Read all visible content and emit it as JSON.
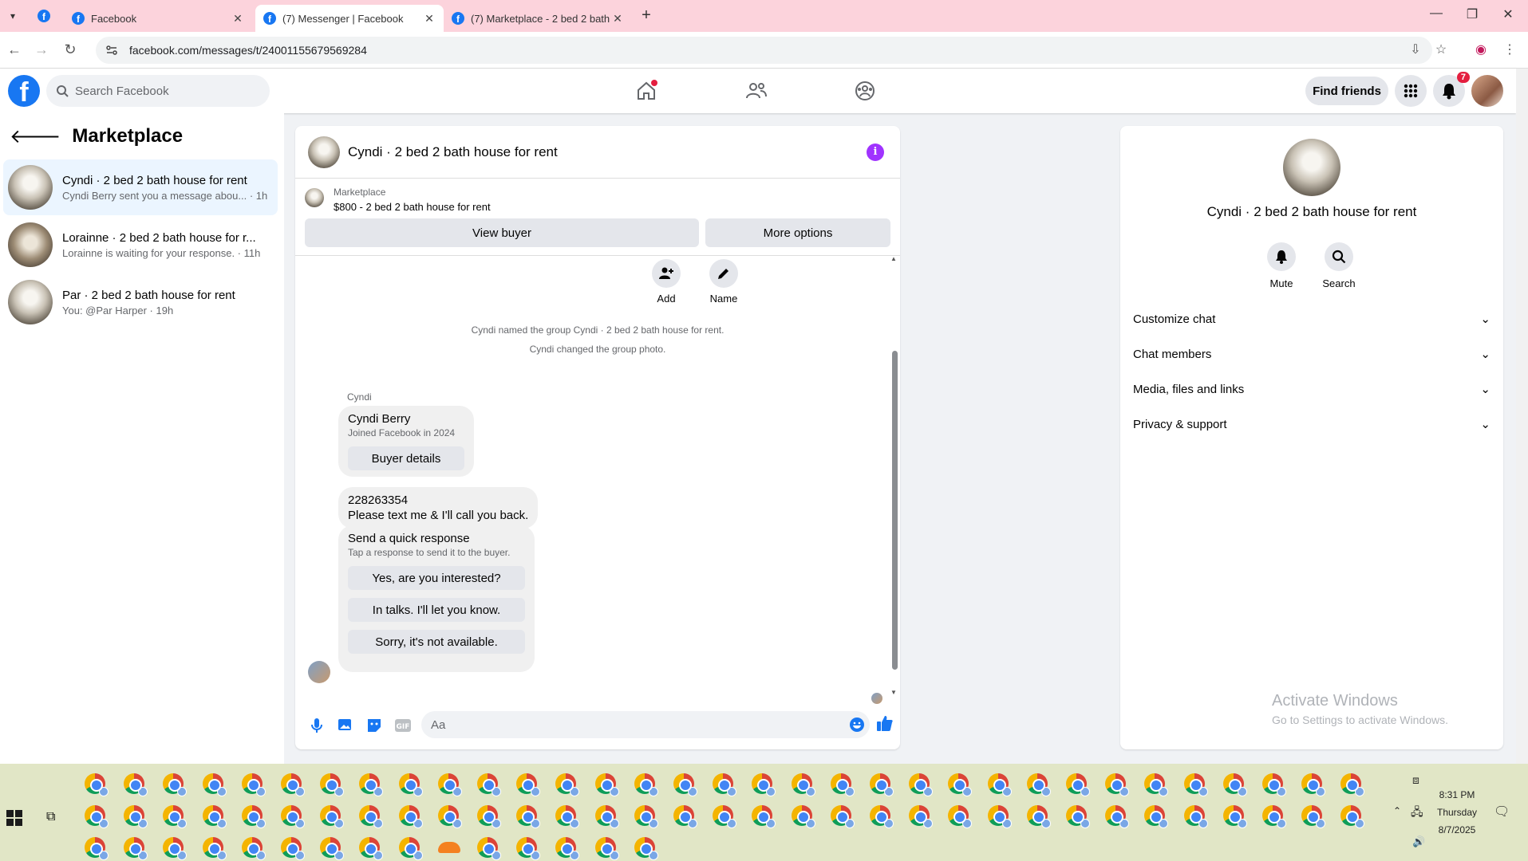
{
  "browser": {
    "tabs": [
      {
        "title": "Facebook",
        "active": false
      },
      {
        "title": "(7) Messenger | Facebook",
        "active": true
      },
      {
        "title": "(7) Marketplace - 2 bed 2 bath",
        "active": false
      }
    ],
    "url": "facebook.com/messages/t/24001155679569284"
  },
  "fb_header": {
    "logo": "f",
    "search_placeholder": "Search Facebook",
    "nav_icons": [
      "home-icon",
      "friends-icon",
      "groups-icon"
    ],
    "find_friends_label": "Find friends",
    "notifications_count": "7"
  },
  "left": {
    "title": "Marketplace",
    "conversations": [
      {
        "name": "Cyndi · 2 bed 2 bath house for rent",
        "preview": "Cyndi Berry sent you a message abou... · 1h",
        "selected": true
      },
      {
        "name": "Lorainne · 2 bed 2 bath house for r...",
        "preview": "Lorainne is waiting for your response. · 11h",
        "selected": false
      },
      {
        "name": "Par · 2 bed 2 bath house for rent",
        "preview": "You: @Par Harper · 19h",
        "selected": false
      }
    ]
  },
  "chat": {
    "title": "Cyndi · 2 bed 2 bath house for rent",
    "listing_label": "Marketplace",
    "listing_value": "$800 - 2 bed 2 bath house for rent",
    "view_buyer_label": "View buyer",
    "more_options_label": "More options",
    "actions": [
      {
        "label": "Add"
      },
      {
        "label": "Name"
      }
    ],
    "system_messages": [
      "Cyndi named the group Cyndi · 2 bed 2 bath house for rent.",
      "Cyndi changed the group photo."
    ],
    "sender_name": "Cyndi",
    "profile_card": {
      "name": "Cyndi Berry",
      "joined": "Joined Facebook in 2024",
      "button": "Buyer details"
    },
    "message_lines": [
      "228263354",
      "Please text me & I'll call you back."
    ],
    "quick_response": {
      "title": "Send a quick response",
      "subtitle": "Tap a response to send it to the buyer.",
      "options": [
        "Yes, are you interested?",
        "In talks. I'll let you know.",
        "Sorry, it's not available."
      ]
    },
    "composer_placeholder": "Aa"
  },
  "right_panel": {
    "title": "Cyndi · 2 bed 2 bath house for rent",
    "actions": [
      {
        "label": "Mute"
      },
      {
        "label": "Search"
      }
    ],
    "sections": [
      "Customize chat",
      "Chat members",
      "Media, files and links",
      "Privacy & support"
    ]
  },
  "watermark": {
    "line1": "Activate Windows",
    "line2": "Go to Settings to activate Windows."
  },
  "taskbar": {
    "time": "8:31 PM",
    "day": "Thursday",
    "date": "8/7/2025"
  },
  "colors": {
    "fb_blue": "#1877f2",
    "info_purple": "#a033ff",
    "notification_red": "#e41e3f",
    "tabstrip_pink": "#fcd3dc",
    "taskbar": "#e1e6c6"
  }
}
